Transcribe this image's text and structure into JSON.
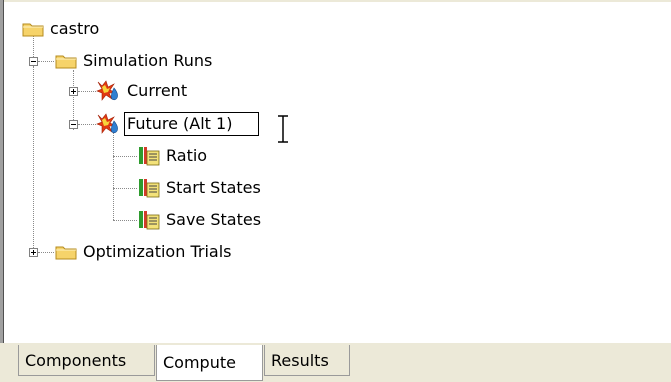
{
  "tree": {
    "root": {
      "label": "castro",
      "icon": "folder-icon"
    },
    "simulation_runs": {
      "label": "Simulation Runs",
      "icon": "folder-icon",
      "expander": "minus"
    },
    "current": {
      "label": "Current",
      "icon": "simulation-run-icon",
      "expander": "plus"
    },
    "future": {
      "label": "Future (Alt 1)",
      "icon": "simulation-run-icon",
      "expander": "minus",
      "state": "editing"
    },
    "ratio": {
      "label": "Ratio",
      "icon": "document-icon"
    },
    "start_states": {
      "label": "Start States",
      "icon": "document-icon"
    },
    "save_states": {
      "label": "Save States",
      "icon": "document-icon"
    },
    "optimization_trials": {
      "label": "Optimization Trials",
      "icon": "folder-icon",
      "expander": "plus"
    }
  },
  "tabs": [
    {
      "label": "Components",
      "active": false
    },
    {
      "label": "Compute",
      "active": true
    },
    {
      "label": "Results",
      "active": false
    }
  ],
  "colors": {
    "folder_fill": "#f6d36a",
    "folder_stroke": "#b58b1e",
    "tab_background": "#ece9d8",
    "tree_background": "#ffffff"
  }
}
